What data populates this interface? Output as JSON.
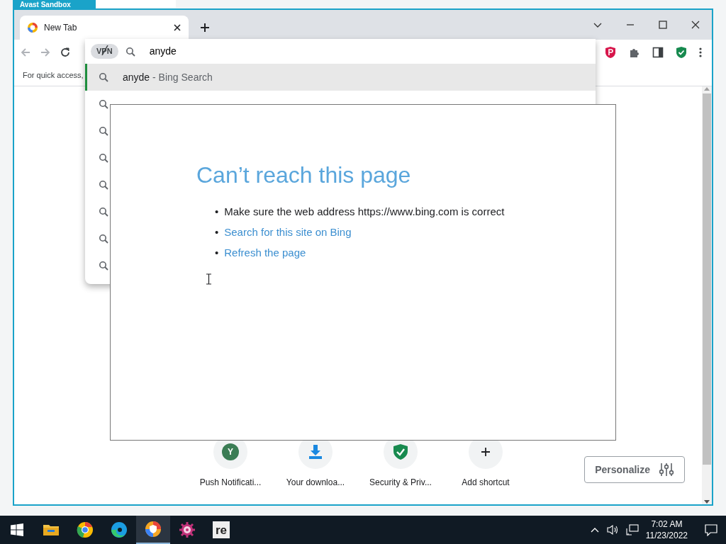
{
  "sandbox": {
    "label": "Avast Sandbox"
  },
  "tabs": [
    {
      "label": "New Tab",
      "selected": true
    }
  ],
  "bookmarks_bar": {
    "text": "For quick access,"
  },
  "omnibox": {
    "vpn_badge": "VPN",
    "value": "anyde"
  },
  "suggestions": [
    {
      "query": "anyde",
      "hint": "- Bing Search",
      "selected": true
    },
    {
      "selected": false
    },
    {
      "selected": false
    },
    {
      "selected": false
    },
    {
      "selected": false
    },
    {
      "selected": false
    },
    {
      "selected": false
    },
    {
      "selected": false
    }
  ],
  "dialog": {
    "title": "Can’t reach this page",
    "items": [
      {
        "kind": "text",
        "bullet": "•",
        "text": "Make sure the web address https://www.bing.com is correct"
      },
      {
        "kind": "link",
        "bullet": "•",
        "text": "Search for this site on Bing"
      },
      {
        "kind": "link",
        "bullet": "•",
        "text": "Refresh the page"
      }
    ]
  },
  "shortcuts": [
    {
      "kind": "letter",
      "letter": "Y",
      "label": "Push Notificati..."
    },
    {
      "kind": "download",
      "label": "Your downloa..."
    },
    {
      "kind": "shield",
      "label": "Security & Priv..."
    },
    {
      "kind": "add",
      "label": "Add shortcut"
    }
  ],
  "personalize": {
    "label": "Personalize"
  },
  "taskbar": {
    "apps": [
      {
        "kind": "explorer",
        "selected": false
      },
      {
        "kind": "chrome",
        "selected": false
      },
      {
        "kind": "edge",
        "selected": false
      },
      {
        "kind": "avast",
        "selected": true
      },
      {
        "kind": "gear",
        "selected": false
      },
      {
        "kind": "re",
        "label": "re",
        "selected": false
      }
    ],
    "time": "7:02 AM",
    "date": "11/23/2022"
  }
}
